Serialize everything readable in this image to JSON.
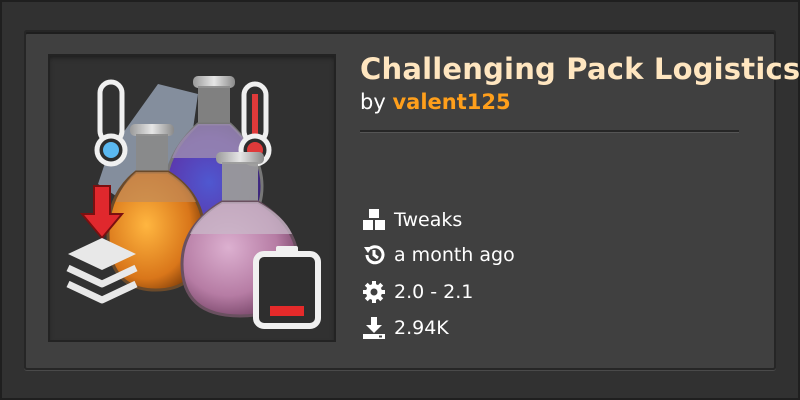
{
  "mod": {
    "title": "Challenging Pack Logistics",
    "by_prefix": "by",
    "author": "valent125"
  },
  "meta": {
    "category": "Tweaks",
    "updated": "a month ago",
    "versions": "2.0 - 2.1",
    "downloads": "2.94K"
  },
  "colors": {
    "title": "#ffe6c0",
    "author": "#ff9f1b",
    "card_bg": "#404040",
    "page_bg": "#313131"
  },
  "icons": [
    "cubes-icon",
    "history-icon",
    "gear-icon",
    "download-icon",
    "thermometer-cold-icon",
    "thermometer-hot-icon",
    "stack-down-icon",
    "battery-low-icon"
  ]
}
